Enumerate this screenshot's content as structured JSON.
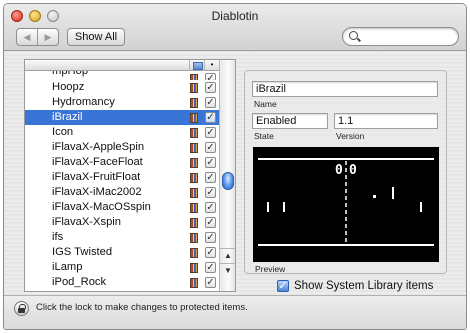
{
  "window": {
    "title": "Diablotin",
    "toolbar": {
      "back_arrow": "◀",
      "forward_arrow": "▶",
      "show_all_label": "Show All",
      "search_placeholder": ""
    }
  },
  "list": {
    "header_col2": "•",
    "items": [
      {
        "label": "mpHop",
        "enabled": true,
        "selected": false
      },
      {
        "label": "Hoopz",
        "enabled": true,
        "selected": false
      },
      {
        "label": "Hydromancy",
        "enabled": true,
        "selected": false
      },
      {
        "label": "iBrazil",
        "enabled": true,
        "selected": true
      },
      {
        "label": "Icon",
        "enabled": true,
        "selected": false
      },
      {
        "label": "iFlavaX-AppleSpin",
        "enabled": true,
        "selected": false
      },
      {
        "label": "iFlavaX-FaceFloat",
        "enabled": true,
        "selected": false
      },
      {
        "label": "iFlavaX-FruitFloat",
        "enabled": true,
        "selected": false
      },
      {
        "label": "iFlavaX-iMac2002",
        "enabled": true,
        "selected": false
      },
      {
        "label": "iFlavaX-MacOSspin",
        "enabled": true,
        "selected": false
      },
      {
        "label": "iFlavaX-Xspin",
        "enabled": true,
        "selected": false
      },
      {
        "label": "ifs",
        "enabled": true,
        "selected": false
      },
      {
        "label": "IGS Twisted",
        "enabled": true,
        "selected": false
      },
      {
        "label": "iLamp",
        "enabled": true,
        "selected": false
      },
      {
        "label": "iPod_Rock",
        "enabled": true,
        "selected": false
      }
    ],
    "check_glyph": "✓"
  },
  "details": {
    "name_value": "iBrazil",
    "name_label": "Name",
    "state_value": "Enabled",
    "state_label": "State",
    "version_value": "1.1",
    "version_label": "Version",
    "preview_label": "Preview",
    "preview_score_left": "0",
    "preview_score_right": "0"
  },
  "show_system_library": {
    "label": "Show System Library items",
    "checked": true
  },
  "footer": {
    "lock_text": "Click the lock to make changes to protected items."
  },
  "colors": {
    "selection": "#3875d7",
    "preview_bg": "#000000",
    "preview_fg": "#ffffff"
  }
}
